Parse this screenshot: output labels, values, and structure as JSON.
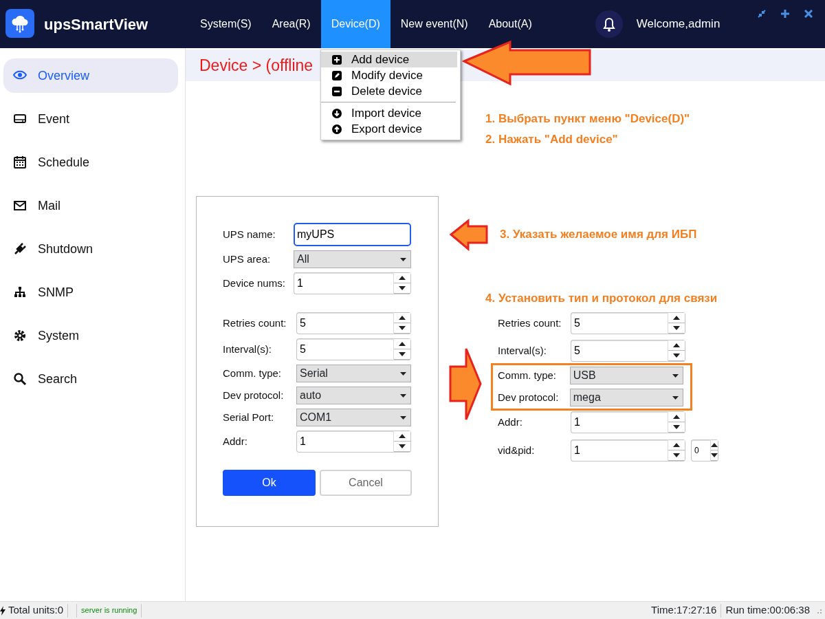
{
  "app": {
    "title": "upsSmartView"
  },
  "menu": [
    {
      "label": "System(S)",
      "selected": false
    },
    {
      "label": "Area(R)",
      "selected": false
    },
    {
      "label": "Device(D)",
      "selected": true
    },
    {
      "label": "New event(N)",
      "selected": false
    },
    {
      "label": "About(A)",
      "selected": false
    }
  ],
  "header": {
    "welcome": "Welcome,admin"
  },
  "sidebar": [
    {
      "label": "Overview",
      "selected": true
    },
    {
      "label": "Event",
      "selected": false
    },
    {
      "label": "Schedule",
      "selected": false
    },
    {
      "label": "Mail",
      "selected": false
    },
    {
      "label": "Shutdown",
      "selected": false
    },
    {
      "label": "SNMP",
      "selected": false
    },
    {
      "label": "System",
      "selected": false
    },
    {
      "label": "Search",
      "selected": false
    }
  ],
  "breadcrumb": "Device > (offline",
  "device_menu": [
    {
      "label": "Add device",
      "highlighted": true,
      "separator_before": false
    },
    {
      "label": "Modify device",
      "highlighted": false,
      "separator_before": false
    },
    {
      "label": "Delete device",
      "highlighted": false,
      "separator_before": false
    },
    {
      "label": "Import device",
      "highlighted": false,
      "separator_before": true
    },
    {
      "label": "Export device",
      "highlighted": false,
      "separator_before": false
    }
  ],
  "dialog": {
    "field_groups": [
      [
        {
          "label": "UPS name:",
          "kind": "text",
          "value": "myUPS",
          "focused": true
        },
        {
          "label": "UPS area:",
          "kind": "select",
          "value": "All"
        },
        {
          "label": "Device nums:",
          "kind": "spin",
          "value": "1"
        }
      ],
      [
        {
          "label": "Retries count:",
          "kind": "spin",
          "value": "5"
        },
        {
          "label": "Interval(s):",
          "kind": "spin",
          "value": "5"
        },
        {
          "label": "Comm. type:",
          "kind": "select",
          "value": "Serial"
        },
        {
          "label": "Dev protocol:",
          "kind": "select",
          "value": "auto"
        },
        {
          "label": "Serial Port:",
          "kind": "select",
          "value": "COM1"
        },
        {
          "label": "Addr:",
          "kind": "spin",
          "value": "1"
        }
      ]
    ],
    "buttons": [
      {
        "label": "Ok",
        "kind": "primary"
      },
      {
        "label": "Cancel",
        "kind": "secondary"
      }
    ]
  },
  "annotations": {
    "steps": [
      "1. Выбрать пункт меню \"Device(D)\"",
      "2. Нажать \"Add device\"",
      "3. Указать желаемое имя для ИБП",
      "4. Установить тип и протокол для связи"
    ],
    "inset_fields": [
      {
        "label": "Retries count:",
        "kind": "spin",
        "value": "5",
        "highlighted": false
      },
      {
        "label": "Interval(s):",
        "kind": "spin",
        "value": "5",
        "highlighted": false
      },
      {
        "label": "Comm. type:",
        "kind": "select",
        "value": "USB",
        "highlighted": true
      },
      {
        "label": "Dev protocol:",
        "kind": "select",
        "value": "mega",
        "highlighted": true
      },
      {
        "label": "Addr:",
        "kind": "spin",
        "value": "1",
        "highlighted": false
      },
      {
        "label": "vid&pid:",
        "kind": "spin",
        "value": "1",
        "extra": "0",
        "highlighted": false
      }
    ]
  },
  "status_bar": {
    "units": "Total units:0",
    "server": "server is running",
    "time": "Time:17:27:16",
    "run_time": "Run time:00:06:38"
  }
}
